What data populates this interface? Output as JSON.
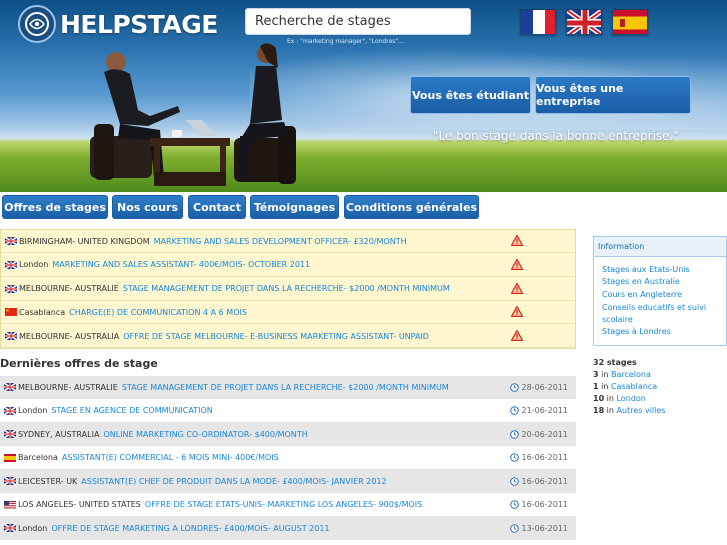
{
  "header": {
    "logo_text": "HELPSTAGE",
    "search_value": "Recherche de stages",
    "search_hint": "Ex : \"marketing manager\", \"Londres\"...",
    "flags": [
      "france-flag",
      "uk-flag",
      "spain-flag"
    ],
    "student_button": "Vous êtes étudiant",
    "company_button": "Vous êtes une entreprise",
    "tagline": "\"Le bon stage dans la bonne entreprise.\""
  },
  "nav": {
    "items": [
      "Offres de stages",
      "Nos cours",
      "Contact",
      "Témoignages",
      "Conditions générales"
    ]
  },
  "featured": [
    {
      "flag": "uk",
      "location": "BIRMINGHAM- UNITED KINGDOM",
      "title": "MARKETING AND SALES DEVELOPMENT OFFICER- £320/MONTH"
    },
    {
      "flag": "uk",
      "location": "London",
      "title": "MARKETING AND SALES ASSISTANT- 400€/MOIS- OCTOBER 2011"
    },
    {
      "flag": "uk",
      "location": "MELBOURNE- AUSTRALIE",
      "title": "STAGE MANAGEMENT DE PROJET DANS LA RECHERCHE- $2000 /MONTH MINIMUM"
    },
    {
      "flag": "cn",
      "location": "Casablanca",
      "title": "CHARGE(E) DE COMMUNICATION 4 A 6 MOIS"
    },
    {
      "flag": "uk",
      "location": "MELBOURNE- AUSTRALIA",
      "title": "OFFRE DE STAGE MELBOURNE- E-BUSINESS MARKETING ASSISTANT- UNPAID"
    }
  ],
  "latest_title": "Dernières offres de stage",
  "latest": [
    {
      "flag": "uk",
      "location": "MELBOURNE- AUSTRALIE",
      "title": "STAGE MANAGEMENT DE PROJET DANS LA RECHERCHE- $2000 /MONTH MINIMUM",
      "date": "28-06-2011"
    },
    {
      "flag": "uk",
      "location": "London",
      "title": "STAGE EN AGENCE DE COMMUNICATION",
      "date": "21-06-2011"
    },
    {
      "flag": "uk",
      "location": "SYDNEY, AUSTRALIA",
      "title": "ONLINE MARKETING CO-ORDINATOR- $400/MONTH",
      "date": "20-06-2011"
    },
    {
      "flag": "es",
      "location": "Barcelona",
      "title": "ASSISTANT(E) COMMERCIAL - 6 MOIS MINI- 400€/MOIS",
      "date": "16-06-2011"
    },
    {
      "flag": "uk",
      "location": "LEICESTER- UK",
      "title": "ASSISTANT(E) CHEF DE PRODUIT DANS LA MODE- £400/MOIS- JANVIER 2012",
      "date": "16-06-2011"
    },
    {
      "flag": "us",
      "location": "LOS ANGELES- UNITED STATES",
      "title": "OFFRE DE STAGE ETATS-UNIS- MARKETING LOS ANGELES- 900$/MOIS",
      "date": "16-06-2011"
    },
    {
      "flag": "uk",
      "location": "London",
      "title": "OFFRE DE STAGE MARKETING A LONDRES- £400/MOIS- AUGUST 2011",
      "date": "13-06-2011"
    }
  ],
  "sidebar": {
    "info_title": "Information",
    "links": [
      "Stages aux Etats-Unis",
      "Stages en Australie",
      "Cours en Angleterre",
      "Conseils educatifs et suivi",
      "scolaire",
      "Stages à Londres"
    ],
    "total": "32 stages",
    "counts": [
      {
        "n": "3",
        "sep": " in ",
        "place": "Barcelona"
      },
      {
        "n": "1",
        "sep": " in ",
        "place": "Casablanca"
      },
      {
        "n": "10",
        "sep": " in ",
        "place": "London"
      },
      {
        "n": "18",
        "sep": " in ",
        "place": "Autres villes"
      }
    ]
  },
  "colors": {
    "link": "#1a86d6",
    "nav_button": "#1f66b0",
    "featured_bg": "#fdf6cf",
    "warning": "#d9261c"
  }
}
